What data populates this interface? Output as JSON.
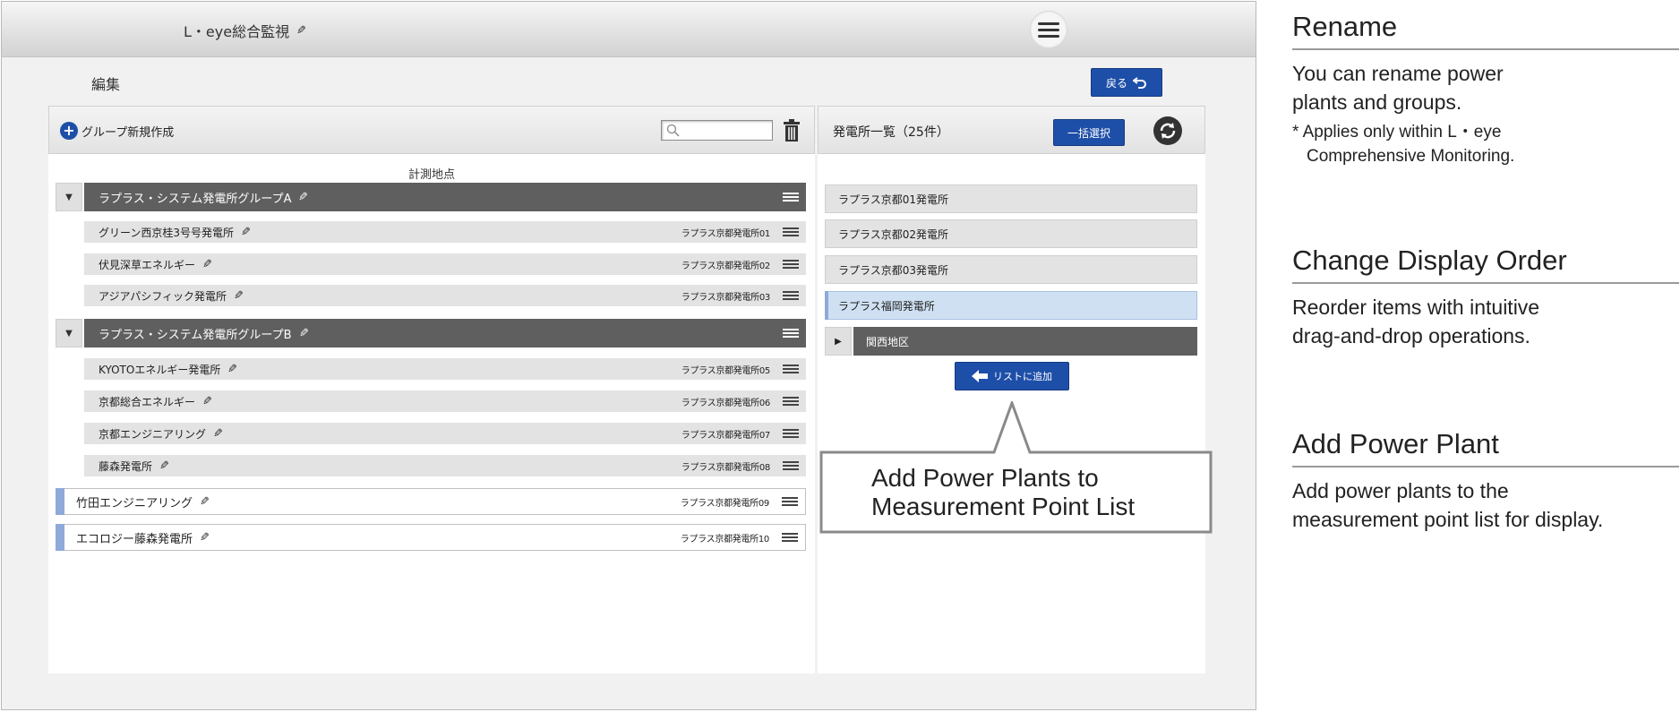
{
  "header": {
    "app_title": "L・eye総合監視",
    "page_title": "編集",
    "back_label": "戻る"
  },
  "left_panel": {
    "new_group_label": "グループ新規作成",
    "search_placeholder": "",
    "column_label": "計測地点",
    "groups": [
      {
        "name": "ラプラス・システム発電所グループA",
        "items": [
          {
            "name": "グリーン西京桂3号号発電所",
            "code": "ラプラス京都発電所01"
          },
          {
            "name": "伏見深草エネルギー",
            "code": "ラプラス京都発電所02"
          },
          {
            "name": "アジアパシフィック発電所",
            "code": "ラプラス京都発電所03"
          }
        ]
      },
      {
        "name": "ラプラス・システム発電所グループB",
        "items": [
          {
            "name": "KYOTOエネルギー発電所",
            "code": "ラプラス京都発電所05"
          },
          {
            "name": "京都総合エネルギー",
            "code": "ラプラス京都発電所06"
          },
          {
            "name": "京都エンジニアリング",
            "code": "ラプラス京都発電所07"
          },
          {
            "name": "藤森発電所",
            "code": "ラプラス京都発電所08"
          }
        ]
      }
    ],
    "standalone": [
      {
        "name": "竹田エンジニアリング",
        "code": "ラプラス京都発電所09"
      },
      {
        "name": "エコロジー藤森発電所",
        "code": "ラプラス京都発電所10"
      }
    ]
  },
  "right_panel": {
    "title": "発電所一覧（25件）",
    "select_all_label": "一括選択",
    "plants": [
      "ラプラス京都01発電所",
      "ラプラス京都02発電所",
      "ラプラス京都03発電所",
      "ラプラス福岡発電所"
    ],
    "region_label": "関西地区",
    "add_label": "リストに追加"
  },
  "callout": {
    "line1": "Add Power Plants to",
    "line2": "Measurement Point List"
  },
  "annotations": {
    "rename_title": "Rename",
    "rename_desc_1": "You can rename power",
    "rename_desc_2": "plants and groups.",
    "rename_note_1": "* Applies only within L・eye",
    "rename_note_2": "Comprehensive Monitoring.",
    "order_title": "Change Display Order",
    "order_desc_1": "Reorder items with intuitive",
    "order_desc_2": "drag-and-drop operations.",
    "add_title": "Add Power Plant",
    "add_desc_1": "Add power plants to the",
    "add_desc_2": "measurement point list for display."
  },
  "colors": {
    "accent_blue": "#1e4fa8",
    "group_bar": "#5f5f5f",
    "selected_row": "#cfe0f3"
  }
}
